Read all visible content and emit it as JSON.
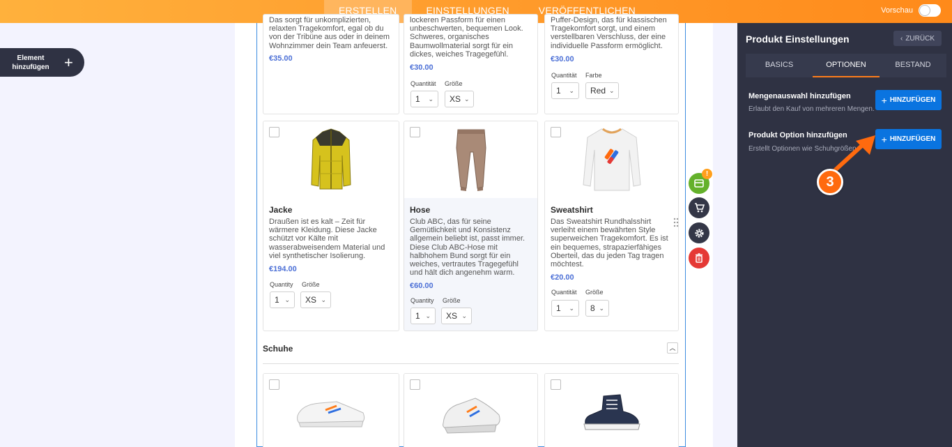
{
  "topnav": {
    "tabs": [
      {
        "label": "ERSTELLEN",
        "active": true
      },
      {
        "label": "EINSTELLUNGEN",
        "active": false
      },
      {
        "label": "VERÖFFENTLICHEN",
        "active": false
      }
    ],
    "preview_label": "Vorschau"
  },
  "add_element": {
    "label": "Element hinzufügen"
  },
  "products_row1": [
    {
      "desc": "Das sorgt für unkomplizierten, relaxten Tragekomfort, egal ob du von der Tribüne aus oder in deinem Wohnzimmer dein Team anfeuerst.",
      "price": "€35.00"
    },
    {
      "desc": "lockeren Passform für einen unbeschwerten, bequemen Look. Schweres, organisches Baumwollmaterial sorgt für ein dickes, weiches Tragegefühl.",
      "price": "€30.00",
      "opt1_label": "Quantität",
      "opt1_value": "1",
      "opt2_label": "Größe",
      "opt2_value": "XS"
    },
    {
      "desc": "Puffer-Design, das für klassischen Tragekomfort sorgt, und einem verstellbaren Verschluss, der eine individuelle Passform ermöglicht.",
      "price": "€30.00",
      "opt1_label": "Quantität",
      "opt1_value": "1",
      "opt2_label": "Farbe",
      "opt2_value": "Red"
    }
  ],
  "products_row2": [
    {
      "name": "Jacke",
      "desc": "Draußen ist es kalt – Zeit für wärmere Kleidung. Diese Jacke schützt vor Kälte mit wasserabweisendem Material und viel synthetischer Isolierung.",
      "price": "€194.00",
      "opt1_label": "Quantity",
      "opt1_value": "1",
      "opt2_label": "Größe",
      "opt2_value": "XS"
    },
    {
      "name": "Hose",
      "desc": "Club ABC, das für seine Gemütlichkeit und Konsistenz allgemein beliebt ist, passt immer. Diese Club ABC-Hose mit halbhohem Bund sorgt für ein weiches, vertrautes Tragegefühl und hält dich angenehm warm.",
      "price": "€60.00",
      "opt1_label": "Quantity",
      "opt1_value": "1",
      "opt2_label": "Größe",
      "opt2_value": "XS"
    },
    {
      "name": "Sweatshirt",
      "desc": "Das Sweatshirt Rundhalsshirt verleiht einem bewährten Style superweichen Tragekomfort. Es ist ein bequemes, strapazierfähiges Oberteil, das du jeden Tag tragen möchtest.",
      "price": "€20.00",
      "opt1_label": "Quantität",
      "opt1_value": "1",
      "opt2_label": "Größe",
      "opt2_value": "8"
    }
  ],
  "section": {
    "title": "Schuhe"
  },
  "fab_badge": "!",
  "panel": {
    "title": "Produkt Einstellungen",
    "back_label": "ZURÜCK",
    "tabs": [
      {
        "label": "BASICS",
        "active": false
      },
      {
        "label": "OPTIONEN",
        "active": true
      },
      {
        "label": "BESTAND",
        "active": false
      }
    ],
    "options": [
      {
        "title": "Mengenauswahl hinzufügen",
        "subtitle": "Erlaubt den Kauf von mehreren Mengen.",
        "button": "HINZUFÜGEN"
      },
      {
        "title": "Produkt Option hinzufügen",
        "subtitle": "Erstellt Optionen wie Schuhgrößen",
        "button": "HINZUFÜGEN"
      }
    ]
  },
  "step_marker": "3",
  "colors": {
    "accent": "#ff8a1a",
    "panel": "#2f3243",
    "primary_button": "#0a74e0",
    "price": "#4b6fd6"
  }
}
